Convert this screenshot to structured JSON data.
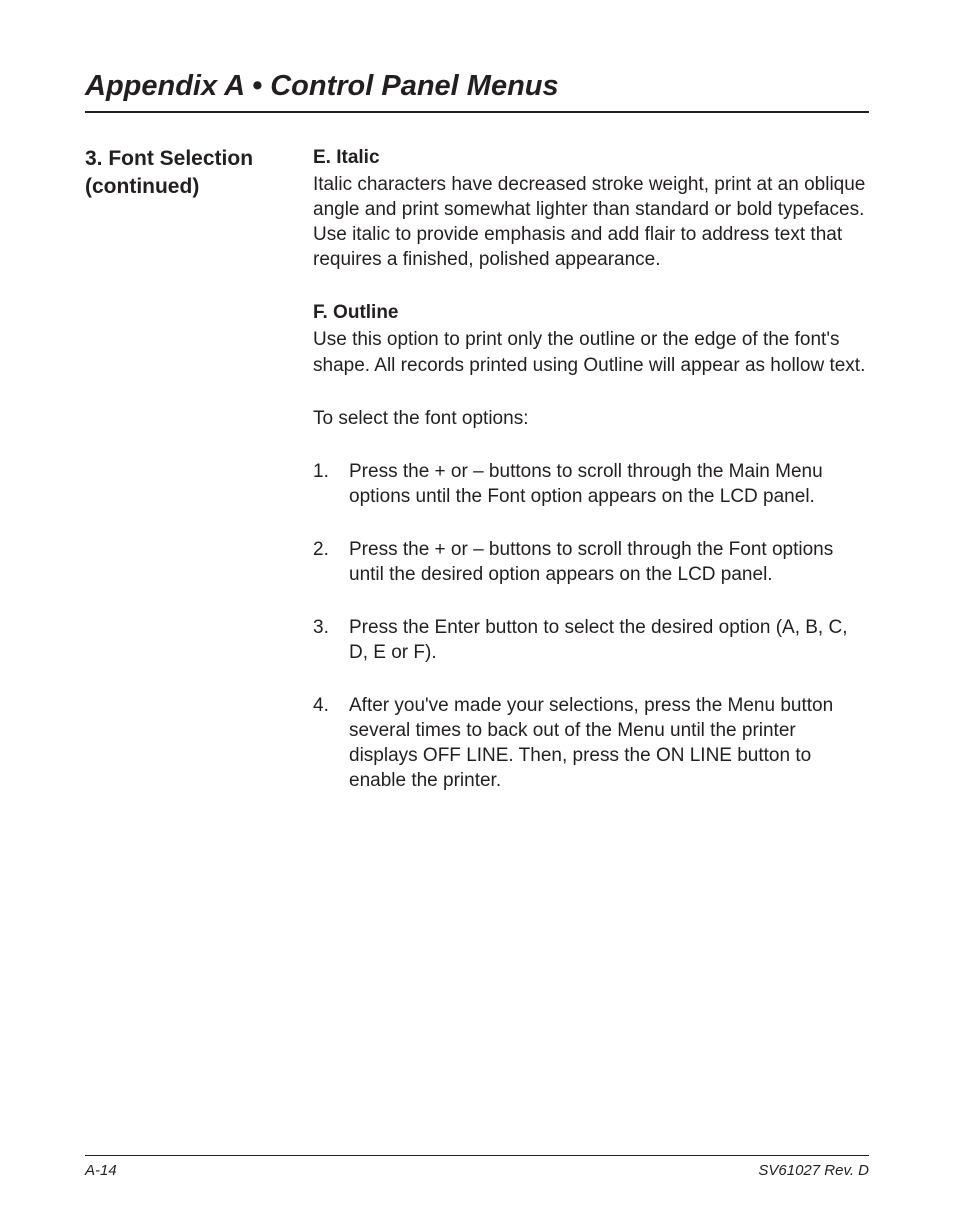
{
  "header": {
    "title": "Appendix A • Control Panel Menus"
  },
  "left": {
    "section_line1": "3.  Font Selection",
    "section_line2": "(continued)"
  },
  "body": {
    "sub_e": "E.  Italic",
    "para_e": "Italic characters have decreased stroke weight, print at an oblique angle and print somewhat lighter than standard or bold typefaces. Use italic to provide emphasis and add flair to address text that requires a finished, polished appearance.",
    "sub_f": "F.  Outline",
    "para_f": "Use this option to print only the outline or the edge of the font's shape. All records printed using Outline will appear as hollow text.",
    "para_select": "To select the font options:",
    "steps": {
      "s1": "Press the + or – buttons to scroll through the Main Menu options until the Font option appears on the LCD panel.",
      "s2": "Press the + or – buttons to scroll through the Font options until the desired option appears on the LCD panel.",
      "s3": "Press the Enter button to select the desired option (A, B, C, D, E or F).",
      "s4": "After you've made your selections, press the Menu button several times to back out of the Menu until the printer displays OFF LINE.  Then, press the ON LINE button to enable the printer."
    }
  },
  "footer": {
    "page": "A-14",
    "rev": "SV61027 Rev. D"
  }
}
